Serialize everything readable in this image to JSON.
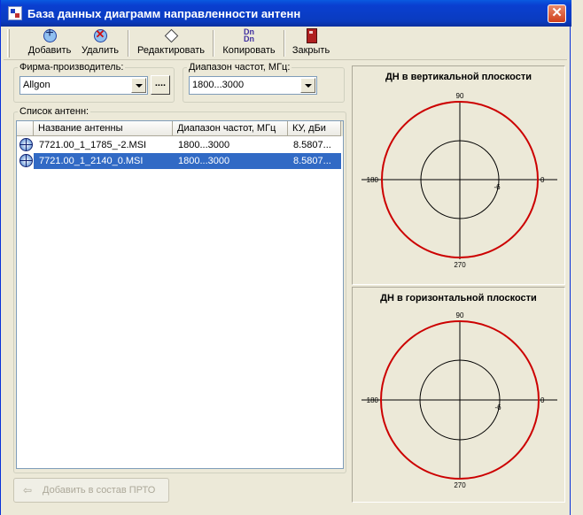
{
  "window": {
    "title": "База данных диаграмм направленности антенн",
    "close_glyph": "✕"
  },
  "toolbar": {
    "add_label": "Добавить",
    "delete_label": "Удалить",
    "edit_label": "Редактировать",
    "copy_label": "Копировать",
    "copy_icon_text_top": "Dn",
    "copy_icon_text_bottom": "Dn",
    "close_label": "Закрыть"
  },
  "manufacturer": {
    "legend": "Фирма-производитель:",
    "value": "Allgon",
    "dots_label": "...."
  },
  "freq_range": {
    "legend": "Диапазон частот, МГц:",
    "value": "1800...3000"
  },
  "antenna_list": {
    "legend": "Список антенн:",
    "columns": [
      "Название антенны",
      "Диапазон частот, МГц",
      "КУ, дБи"
    ],
    "rows": [
      {
        "name": "7721.00_1_1785_-2.MSI",
        "range": "1800...3000",
        "gain": "8.5807..."
      },
      {
        "name": "7721.00_1_2140_0.MSI",
        "range": "1800...3000",
        "gain": "8.5807..."
      }
    ],
    "selected_row": 1
  },
  "add_to_prto": {
    "label": "Добавить в состав ПРТО",
    "arrow_glyph": "⇦"
  },
  "vertical_plot": {
    "title": "ДН в вертикальной плоскости",
    "labels": {
      "top": "90",
      "bottom": "270",
      "left": "180",
      "right": "0",
      "inner": "-6"
    }
  },
  "horizontal_plot": {
    "title": "ДН в горизонтальной плоскости",
    "labels": {
      "top": "90",
      "bottom": "270",
      "left": "180",
      "right": "0",
      "inner": "-6"
    }
  },
  "colors": {
    "pattern": "#cc0000",
    "selection": "#316ac5"
  },
  "icons": [
    "add-icon",
    "delete-icon",
    "edit-icon",
    "copy-icon",
    "close-icon",
    "antenna-icon",
    "arrow-left-icon"
  ]
}
